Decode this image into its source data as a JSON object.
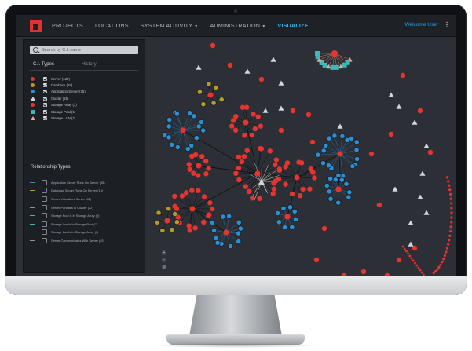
{
  "nav": {
    "items": [
      {
        "label": "PROJECTS",
        "caret": ""
      },
      {
        "label": "LOCATIONS",
        "caret": ""
      },
      {
        "label": "SYSTEM ACTIVITY",
        "caret": "▼"
      },
      {
        "label": "ADMINISTRATION",
        "caret": "▼"
      },
      {
        "label": "VISUALIZE",
        "caret": ""
      }
    ],
    "active_index": 4,
    "welcome_text": "Welcome User",
    "kebab": "⋮"
  },
  "panel": {
    "search_placeholder": "Search by C.I. name",
    "tabs": [
      "C.I. Types",
      "History"
    ],
    "ci_types": [
      {
        "marker": "dot",
        "color": "#e8342f",
        "label": "Server (135)"
      },
      {
        "marker": "dot",
        "color": "#b79a2b",
        "label": "Database (15)"
      },
      {
        "marker": "dot",
        "color": "#2b8fd6",
        "label": "Application Server (35)"
      },
      {
        "marker": "tri",
        "color": "#cfd6dc",
        "label": "Cluster (25)"
      },
      {
        "marker": "dot",
        "color": "#e8342f",
        "label": "Storage Array (7)"
      },
      {
        "marker": "sq",
        "color": "#3fb8b8",
        "label": "Storage Pool (6)"
      },
      {
        "marker": "tri",
        "color": "#f0a58f",
        "label": "Storage LUN (2)"
      }
    ],
    "relationship_title": "Relationship Types",
    "relationships": [
      {
        "color": "#2b8fd6",
        "label": "Application Server Runs On Server (45)"
      },
      {
        "color": "#b79a2b",
        "label": "Database Server Runs On Server (15)"
      },
      {
        "color": "#8a9199",
        "label": "Server Virtualizes Server (81)"
      },
      {
        "color": "#8a9199",
        "label": "Server Partakes In Cluster (22)"
      },
      {
        "color": "#3fb8b8",
        "label": "Storage Pool is In Storage Array (6)"
      },
      {
        "color": "#3fb8b8",
        "label": "Storage Lun Is In Storage Pool (7)"
      },
      {
        "color": "#e8342f",
        "label": "Storage Lun Is In Storage Array (7)"
      },
      {
        "color": "#8a9199",
        "label": "Server Communicates With Server (45)"
      }
    ]
  },
  "zoom": {
    "in": "+",
    "out": "−",
    "fit": "◎"
  },
  "colors": {
    "server": "#e8342f",
    "database": "#b79a2b",
    "app_server": "#2b8fd6",
    "cluster": "#cfd6dc",
    "storage_pool": "#3fb8b8",
    "storage_lun": "#f0a58f",
    "edge": "#0f1216"
  }
}
